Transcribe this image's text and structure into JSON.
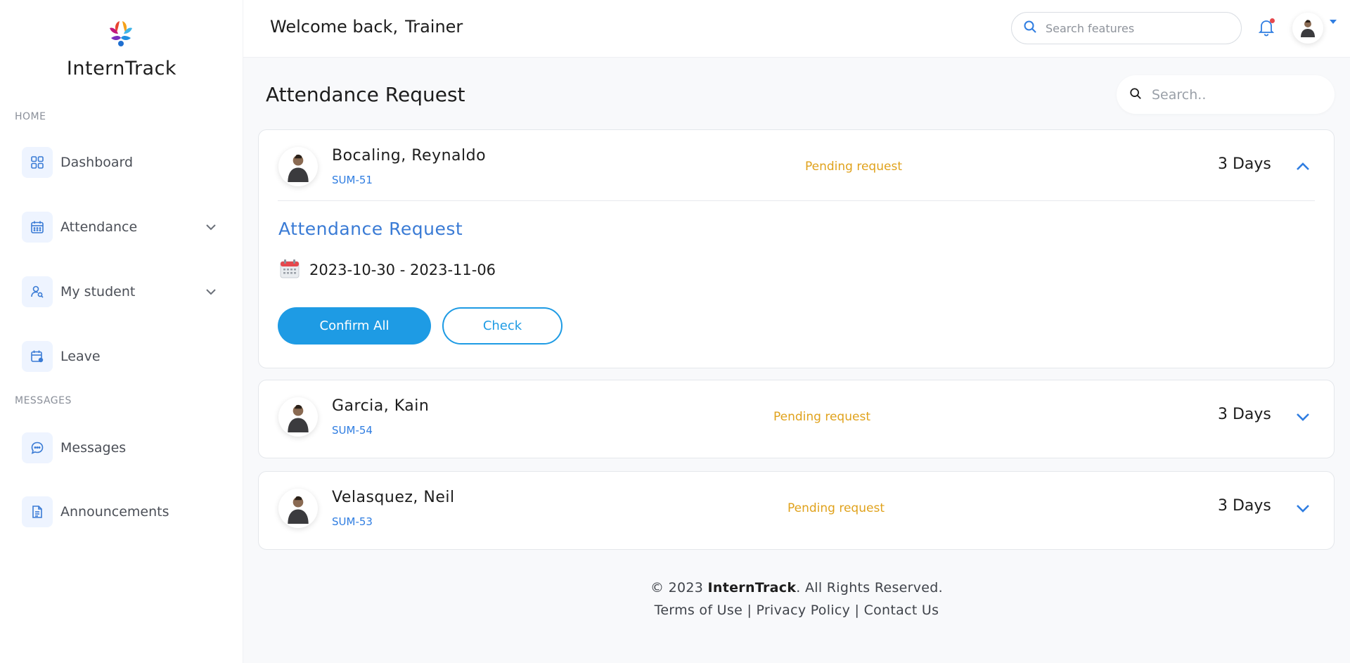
{
  "app": {
    "brand": "InternTrack"
  },
  "sidebar": {
    "sections": [
      {
        "label": "HOME"
      },
      {
        "label": "MESSAGES"
      }
    ],
    "items": [
      {
        "label": "Dashboard",
        "icon": "grid-icon"
      },
      {
        "label": "Attendance",
        "icon": "calendar-icon",
        "has_submenu": true
      },
      {
        "label": "My student",
        "icon": "user-search-icon",
        "has_submenu": true
      },
      {
        "label": "Leave",
        "icon": "calendar-clock-icon"
      },
      {
        "label": "Messages",
        "icon": "chat-icon"
      },
      {
        "label": "Announcements",
        "icon": "document-icon"
      }
    ]
  },
  "header": {
    "welcome": "Welcome back,",
    "user_name": "Trainer",
    "search_placeholder": "Search features",
    "has_notification": true
  },
  "main": {
    "title": "Attendance Request",
    "search_placeholder": "Search..",
    "requests": [
      {
        "name": "Bocaling,  Reynaldo",
        "code": "SUM-51",
        "status": "Pending request",
        "days": "3 Days",
        "expanded": true,
        "detail": {
          "title": "Attendance Request",
          "date_from": "2023-10-30",
          "date_sep": "-",
          "date_to": "2023-11-06",
          "confirm_label": "Confirm All",
          "check_label": "Check"
        }
      },
      {
        "name": "Garcia,  Kain",
        "code": "SUM-54",
        "status": "Pending request",
        "days": "3 Days",
        "expanded": false
      },
      {
        "name": "Velasquez,  Neil",
        "code": "SUM-53",
        "status": "Pending request",
        "days": "3 Days",
        "expanded": false
      }
    ]
  },
  "footer": {
    "copyright_prefix": "© 2023 ",
    "brand": "InternTrack",
    "copyright_suffix": ". All Rights Reserved.",
    "links": [
      "Terms of Use",
      "Privacy Policy",
      "Contact Us"
    ],
    "separator": "|"
  },
  "colors": {
    "accent": "#2f7de1",
    "primary_button": "#1e9be4",
    "pending": "#e0a21c",
    "notification": "#e5484d"
  }
}
